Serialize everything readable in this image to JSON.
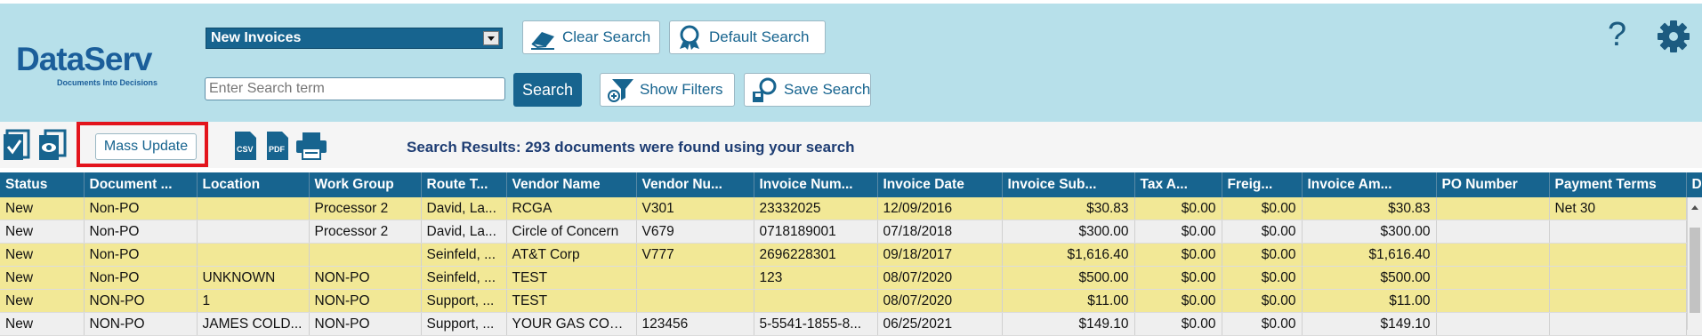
{
  "logo": {
    "name": "DataServ",
    "tagline": "Documents Into Decisions"
  },
  "search": {
    "saved_search": "New Invoices",
    "placeholder": "Enter Search term",
    "value": "",
    "search_label": "Search",
    "clear_label": "Clear Search",
    "default_label": "Default Search",
    "filters_label": "Show Filters",
    "save_label": "Save Search"
  },
  "header_icons": {
    "help": "?",
    "settings": "gear-icon"
  },
  "toolbar": {
    "mass_update_label": "Mass Update",
    "csv": "CSV",
    "pdf": "PDF",
    "results_text": "Search Results: 293 documents were found using your search"
  },
  "grid": {
    "columns": [
      "Status",
      "Document ...",
      "Location",
      "Work Group",
      "Route T...",
      "Vendor Name",
      "Vendor Nu...",
      "Invoice Num...",
      "Invoice Date",
      "Invoice Sub...",
      "Tax A...",
      "Freig...",
      "Invoice Am...",
      "PO Number",
      "Payment Terms",
      "D"
    ],
    "rows": [
      [
        "New",
        "Non-PO",
        "",
        "Processor 2",
        "David, La...",
        "RCGA",
        "V301",
        "23332025",
        "12/09/2016",
        "$30.83",
        "$0.00",
        "$0.00",
        "$30.83",
        "",
        "Net 30",
        ""
      ],
      [
        "New",
        "Non-PO",
        "",
        "Processor 2",
        "David, La...",
        "Circle of Concern",
        "V679",
        "0718189001",
        "07/18/2018",
        "$300.00",
        "$0.00",
        "$0.00",
        "$300.00",
        "",
        "",
        ""
      ],
      [
        "New",
        "Non-PO",
        "",
        "",
        "Seinfeld, ...",
        "AT&T Corp",
        "V777",
        "2696228301",
        "09/18/2017",
        "$1,616.40",
        "$0.00",
        "$0.00",
        "$1,616.40",
        "",
        "",
        ""
      ],
      [
        "New",
        "Non-PO",
        "UNKNOWN",
        "NON-PO",
        "Seinfeld, ...",
        "TEST",
        "",
        "123",
        "08/07/2020",
        "$500.00",
        "$0.00",
        "$0.00",
        "$500.00",
        "",
        "",
        ""
      ],
      [
        "New",
        "NON-PO",
        "1",
        "NON-PO",
        "Support, ...",
        "TEST",
        "",
        "",
        "08/07/2020",
        "$11.00",
        "$0.00",
        "$0.00",
        "$11.00",
        "",
        "",
        ""
      ],
      [
        "New",
        "NON-PO",
        "JAMES COLD...",
        "NON-PO",
        "Support, ...",
        "YOUR GAS COM...",
        "123456",
        "5-5541-1855-8...",
        "06/25/2021",
        "$149.10",
        "$0.00",
        "$0.00",
        "$149.10",
        "",
        "",
        ""
      ]
    ]
  },
  "colors": {
    "header_bg": "#b7e0ea",
    "primary": "#17648f",
    "row_yellow": "#f2e896",
    "highlight": "#e3141c"
  }
}
